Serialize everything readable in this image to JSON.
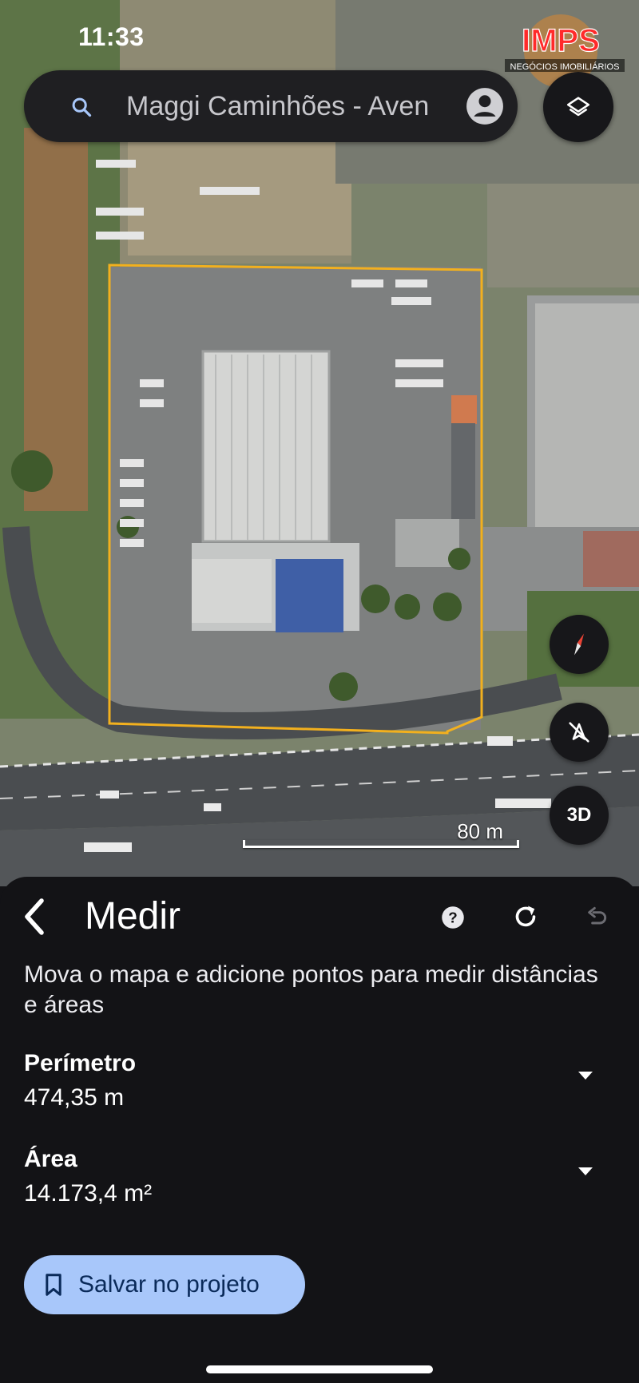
{
  "status_bar": {
    "time": "11:33"
  },
  "watermark": {
    "brand": "IMPS",
    "tagline": "NEGÓCIOS IMOBILIÁRIOS"
  },
  "search": {
    "query": "Maggi Caminhões - Aven",
    "icon": "search-icon"
  },
  "map": {
    "scale_label": "80 m",
    "controls": {
      "three_d_label": "3D"
    },
    "outline_color": "#f2b01e"
  },
  "measure_panel": {
    "title": "Medir",
    "instructions": "Mova o mapa e adicione pontos para medir distâncias e áreas",
    "perimeter": {
      "label": "Perímetro",
      "value": "474,35 m"
    },
    "area": {
      "label": "Área",
      "value": "14.173,4 m²"
    },
    "save_button_label": "Salvar no projeto"
  }
}
